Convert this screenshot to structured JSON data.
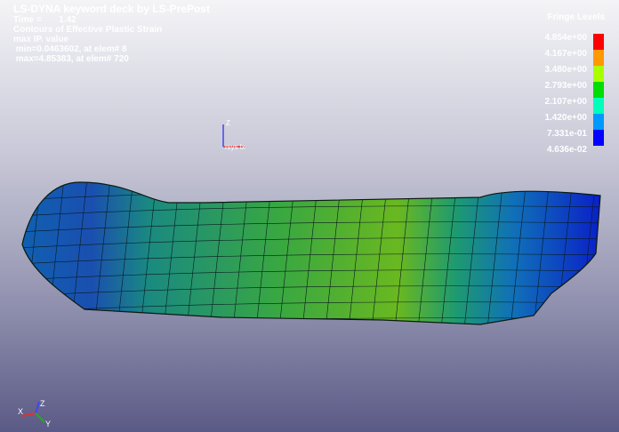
{
  "header": {
    "title": "LS-DYNA keyword deck by LS-PrePost",
    "time": "Time =       1.42",
    "contour": "Contours of Effective Plastic Strain",
    "mode": "max IP. value",
    "min": " min=0.0463602, at elem# 8",
    "max": " max=4.85383, at elem# 720"
  },
  "legend": {
    "title": "Fringe Levels",
    "levels": [
      "4.854e+00",
      "4.167e+00",
      "3.480e+00",
      "2.793e+00",
      "2.107e+00",
      "1.420e+00",
      "7.331e-01",
      "4.636e-02"
    ],
    "colors": [
      "#ff0000",
      "#ff9900",
      "#aaff00",
      "#00dd00",
      "#00ffbb",
      "#0099ff",
      "#0000ff"
    ]
  },
  "triad": {
    "z": "Z",
    "x": "X",
    "y": "Y",
    "label": "rsys lx"
  }
}
